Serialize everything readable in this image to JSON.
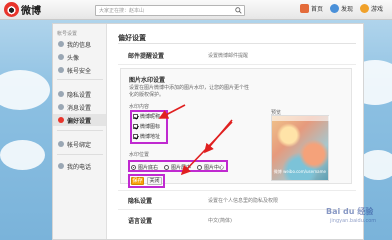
{
  "app": {
    "name": "微博"
  },
  "search": {
    "placeholder": "大家正在搜：赵本山"
  },
  "nav": {
    "home": "首页",
    "discover": "发现",
    "game": "游戏"
  },
  "sidebar": {
    "section_title": "帐号设置",
    "items": [
      {
        "label": "我的信息",
        "icon": "user-info-icon"
      },
      {
        "label": "头像",
        "icon": "avatar-icon"
      },
      {
        "label": "帐号安全",
        "icon": "lock-icon"
      },
      {
        "label": "隐私设置",
        "icon": "privacy-icon"
      },
      {
        "label": "消息设置",
        "icon": "message-icon"
      },
      {
        "label": "偏好设置",
        "icon": "preference-icon",
        "active": true
      },
      {
        "label": "帐号绑定",
        "icon": "bind-icon"
      },
      {
        "label": "我的电话",
        "icon": "phone-icon"
      }
    ]
  },
  "main": {
    "title": "偏好设置",
    "rows": [
      {
        "label": "邮件提醒设置",
        "value": "设置微博邮件提醒"
      },
      {
        "label": "隐私设置",
        "value": "设置在个人信息里的隐私及权限"
      },
      {
        "label": "语言设置",
        "value": "中文(简体)"
      }
    ],
    "watermark_panel": {
      "title": "图片水印设置",
      "desc": "设置在图片微博中添加的图片水印，让您的图片更个性化的版权保护。",
      "content_label": "水印内容",
      "checkboxes": [
        {
          "label": "微博昵称",
          "checked": true
        },
        {
          "label": "微博图标",
          "checked": true
        },
        {
          "label": "微博地址",
          "checked": true
        }
      ],
      "position_label": "水印位置",
      "radios": [
        {
          "label": "图片底右",
          "selected": true
        },
        {
          "label": "图片居中",
          "selected": false
        },
        {
          "label": "图片中心",
          "selected": false
        }
      ],
      "preview_label": "预览",
      "preview_watermark": "微博 weibo.com/username",
      "save_label": "保存",
      "close_label": "关闭"
    }
  },
  "watermark_site": {
    "text": "Bai du 经验",
    "sub": "jingyan.baidu.com"
  },
  "colors": {
    "highlight": "#c02ad0",
    "save_button": "#f7a20b",
    "brand_red": "#e8342b"
  }
}
